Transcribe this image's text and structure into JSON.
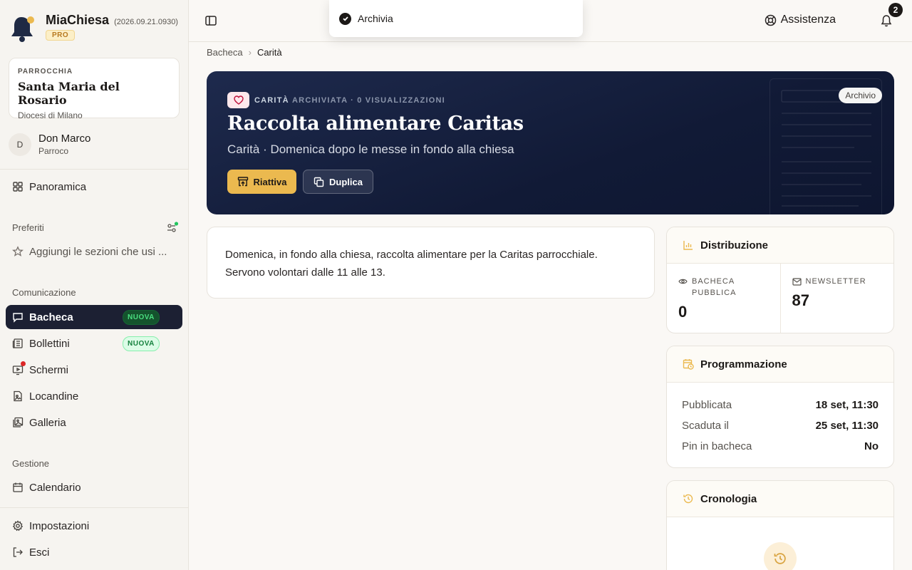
{
  "brand": {
    "name": "MiaChiesa",
    "version": "(2026.09.21.0930)",
    "plan": "PRO"
  },
  "parish": {
    "kicker": "PARROCCHIA",
    "name": "Santa Maria del Rosario",
    "diocese": "Diocesi di Milano"
  },
  "user": {
    "initial": "D",
    "name": "Don Marco",
    "role": "Parroco"
  },
  "nav": {
    "overview": "Panoramica",
    "favorites_label": "Preferiti",
    "favorites_hint": "Aggiungi le sezioni che usi ...",
    "communication_label": "Comunicazione",
    "items": [
      {
        "label": "Bacheca",
        "badge": "NUOVA"
      },
      {
        "label": "Bollettini",
        "badge": "NUOVA"
      },
      {
        "label": "Schermi"
      },
      {
        "label": "Locandine"
      },
      {
        "label": "Galleria"
      }
    ],
    "management_label": "Gestione",
    "calendar": "Calendario",
    "settings": "Impostazioni",
    "logout": "Esci"
  },
  "topbar": {
    "help": "Assistenza",
    "notifications": "2"
  },
  "toast": {
    "message": "Archivia"
  },
  "breadcrumb": {
    "root": "Bacheca",
    "current": "Carità"
  },
  "hero": {
    "category": "CARITÀ",
    "status": "ARCHIVIATA · 0 VISUALIZZAZIONI",
    "tag": "Archivio",
    "title": "Raccolta alimentare Caritas",
    "subtitle": "Carità · Domenica dopo le messe in fondo alla chiesa",
    "reactivate": "Riattiva",
    "duplicate": "Duplica"
  },
  "description": "Domenica, in fondo alla chiesa, raccolta alimentare per la Caritas parrocchiale. Servono volontari dalle 11 alle 13.",
  "distribution": {
    "title": "Distribuzione",
    "board_label": "BACHECA PUBBLICA",
    "board_value": "0",
    "newsletter_label": "NEWSLETTER",
    "newsletter_value": "87"
  },
  "schedule": {
    "title": "Programmazione",
    "rows": [
      {
        "k": "Pubblicata",
        "v": "18 set, 11:30"
      },
      {
        "k": "Scaduta il",
        "v": "25 set, 11:30"
      },
      {
        "k": "Pin in bacheca",
        "v": "No"
      }
    ]
  },
  "history": {
    "title": "Cronologia"
  },
  "colors": {
    "navy": "#1c2033",
    "accent": "#ebb94f",
    "hero": "#111a36",
    "new_badge": "#15803d"
  }
}
